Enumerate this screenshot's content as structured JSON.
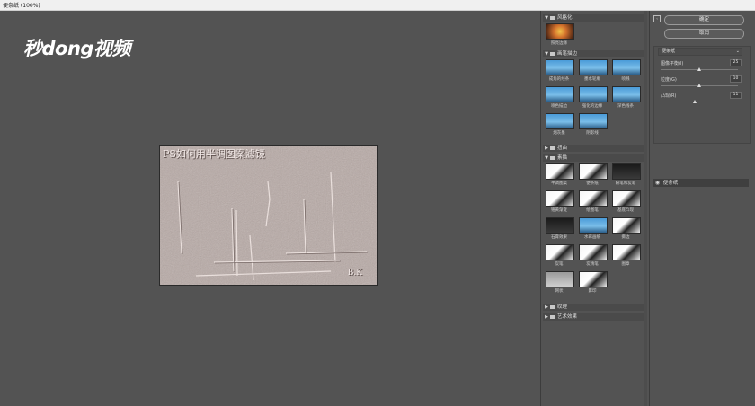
{
  "window": {
    "title": "便条纸 (100%)"
  },
  "watermark": {
    "text": "秒dong视频"
  },
  "canvas": {
    "overlay_text": "PS如何用半调图案滤镜",
    "corner_mark": "B.K"
  },
  "gallery": {
    "categories": [
      {
        "label": "风格化",
        "expanded": true,
        "items": [
          {
            "label": "照亮边缘",
            "icon": "orange"
          }
        ]
      },
      {
        "label": "画笔描边",
        "expanded": true,
        "items": [
          {
            "label": "成角的线条",
            "icon": "sunny"
          },
          {
            "label": "墨水轮廓",
            "icon": "sunny"
          },
          {
            "label": "喷溅",
            "icon": "sunny"
          },
          {
            "label": "喷色描边",
            "icon": "sunny"
          },
          {
            "label": "强化的边缘",
            "icon": "sunny"
          },
          {
            "label": "深色线条",
            "icon": "sunny"
          },
          {
            "label": "烟灰墨",
            "icon": "sunny"
          },
          {
            "label": "阴影线",
            "icon": "sunny"
          }
        ]
      },
      {
        "label": "扭曲",
        "expanded": false,
        "items": []
      },
      {
        "label": "素描",
        "expanded": true,
        "items": [
          {
            "label": "半调图案",
            "icon": "bw"
          },
          {
            "label": "便条纸",
            "icon": "bw"
          },
          {
            "label": "粉笔和炭笔",
            "icon": "dark"
          },
          {
            "label": "铬黄渐变",
            "icon": "bw"
          },
          {
            "label": "绘图笔",
            "icon": "bw"
          },
          {
            "label": "基底凸现",
            "icon": "bw"
          },
          {
            "label": "石膏效果",
            "icon": "dark"
          },
          {
            "label": "水彩画纸",
            "icon": "sunny"
          },
          {
            "label": "撕边",
            "icon": "bw"
          },
          {
            "label": "炭笔",
            "icon": "bw"
          },
          {
            "label": "炭精笔",
            "icon": "bw"
          },
          {
            "label": "图章",
            "icon": "bw"
          },
          {
            "label": "网状",
            "icon": "gray"
          },
          {
            "label": "影印",
            "icon": "bw"
          }
        ]
      },
      {
        "label": "纹理",
        "expanded": false,
        "items": []
      },
      {
        "label": "艺术效果",
        "expanded": false,
        "items": []
      }
    ]
  },
  "settings": {
    "ok_label": "确定",
    "cancel_label": "取消",
    "filter_select": "便条纸",
    "params": [
      {
        "label": "图像平衡(I)",
        "value": "25",
        "fraction": 0.5
      },
      {
        "label": "粒度(G)",
        "value": "10",
        "fraction": 0.5
      },
      {
        "label": "凸现(R)",
        "value": "11",
        "fraction": 0.44
      }
    ],
    "effect_layers": [
      {
        "label": "便条纸",
        "visible": true
      }
    ]
  }
}
